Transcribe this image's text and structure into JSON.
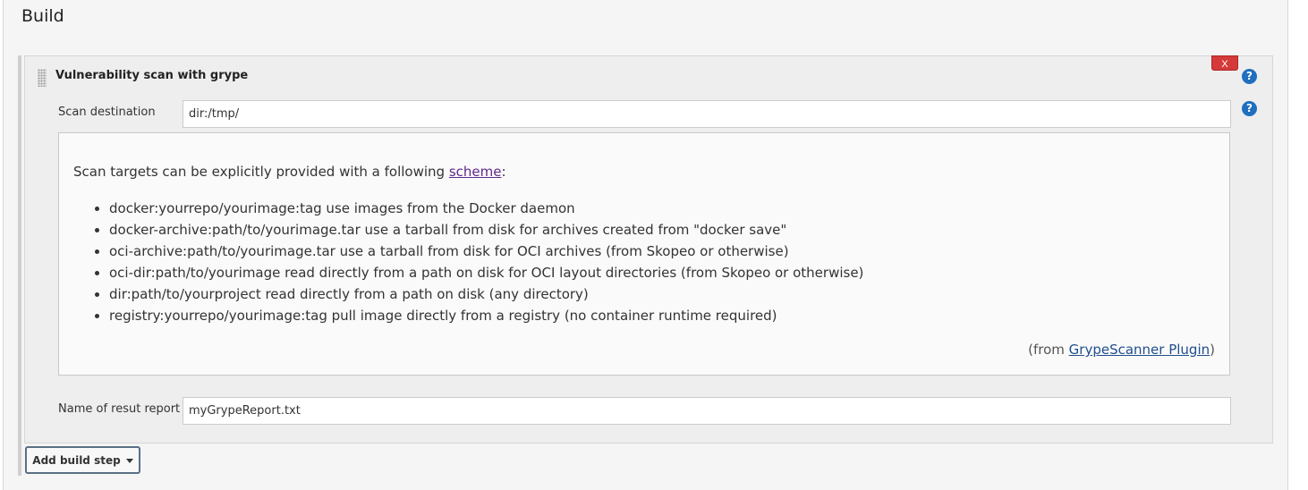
{
  "section": {
    "title": "Build"
  },
  "step": {
    "title": "Vulnerability scan with grype",
    "delete_label": "X",
    "help_icon": "question-circle-icon",
    "scan_destination": {
      "label": "Scan destination",
      "value": "dir:/tmp/"
    },
    "help": {
      "intro_prefix": "Scan targets can be explicitly provided with a following ",
      "intro_link": "scheme",
      "intro_suffix": ":",
      "items": [
        "docker:yourrepo/yourimage:tag use images from the Docker daemon",
        "docker-archive:path/to/yourimage.tar use a tarball from disk for archives created from \"docker save\"",
        "oci-archive:path/to/yourimage.tar use a tarball from disk for OCI archives (from Skopeo or otherwise)",
        "oci-dir:path/to/yourimage read directly from a path on disk for OCI layout directories (from Skopeo or otherwise)",
        "dir:path/to/yourproject read directly from a path on disk (any directory)",
        "registry:yourrepo/yourimage:tag pull image directly from a registry (no container runtime required)"
      ],
      "footer_prefix": "(from ",
      "footer_link": "GrypeScanner Plugin",
      "footer_suffix": ")"
    },
    "report_name": {
      "label": "Name of resut report",
      "value": "myGrypeReport.txt"
    }
  },
  "add_build_step": {
    "label": "Add build step"
  },
  "colors": {
    "delete": "#d43a3a",
    "help_icon": "#1f6fbf",
    "visited_link": "#5e2a8c"
  }
}
